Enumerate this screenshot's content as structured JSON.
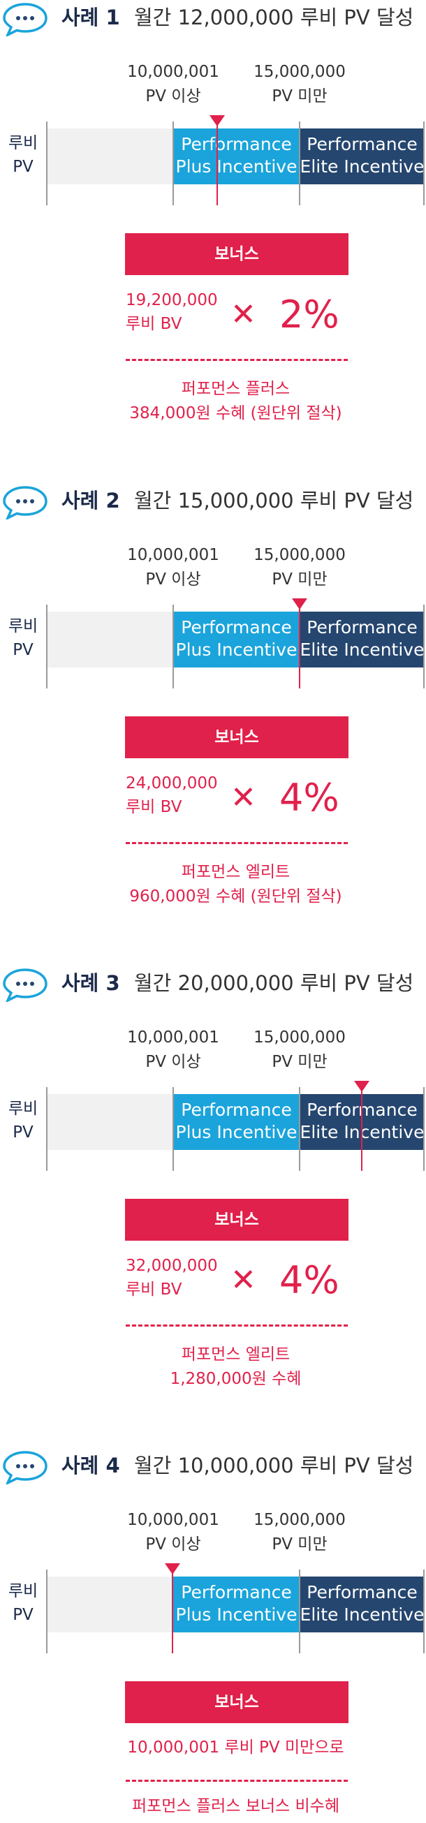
{
  "labels": {
    "axis_label_line1": "루비",
    "axis_label_line2": "PV",
    "threshold1_line1": "10,000,001",
    "threshold1_line2": "PV 이상",
    "threshold2_line1": "15,000,000",
    "threshold2_line2": "PV 미만",
    "plus_line1": "Performance",
    "plus_line2": "Plus Incentive",
    "elite_line1": "Performance",
    "elite_line2": "Elite Incentive",
    "bonus": "보너스",
    "times_symbol": "✕"
  },
  "colors": {
    "accent_red": "#e0214b",
    "plus_blue": "#1aa4db",
    "elite_navy": "#25466f",
    "title_navy": "#1b2a4a"
  },
  "icons": {
    "case_icon": "speech-bubble-icon"
  },
  "cases": [
    {
      "title": "사례 1",
      "subtitle": "월간 12,000,000 루비 PV 달성",
      "bv_amount": "19,200,000",
      "bv_label": "루비 BV",
      "rate": "2%",
      "result_line1": "퍼포먼스 플러스",
      "result_line2": "384,000원 수혜 (원단위 절삭)",
      "pv_marker_value": 12000000
    },
    {
      "title": "사례 2",
      "subtitle": "월간 15,000,000 루비 PV 달성",
      "bv_amount": "24,000,000",
      "bv_label": "루비 BV",
      "rate": "4%",
      "result_line1": "퍼포먼스 엘리트",
      "result_line2": "960,000원 수혜 (원단위 절삭)",
      "pv_marker_value": 15000000
    },
    {
      "title": "사례 3",
      "subtitle": "월간 20,000,000 루비 PV 달성",
      "bv_amount": "32,000,000",
      "bv_label": "루비 BV",
      "rate": "4%",
      "result_line1": "퍼포먼스 엘리트",
      "result_line2": "1,280,000원 수혜",
      "pv_marker_value": 20000000
    },
    {
      "title": "사례 4",
      "subtitle": "월간 10,000,000 루비 PV 달성",
      "message": "10,000,001 루비 PV 미만으로",
      "result_line1": "퍼포먼스 플러스 보너스 비수혜",
      "pv_marker_value": 10000000
    }
  ]
}
